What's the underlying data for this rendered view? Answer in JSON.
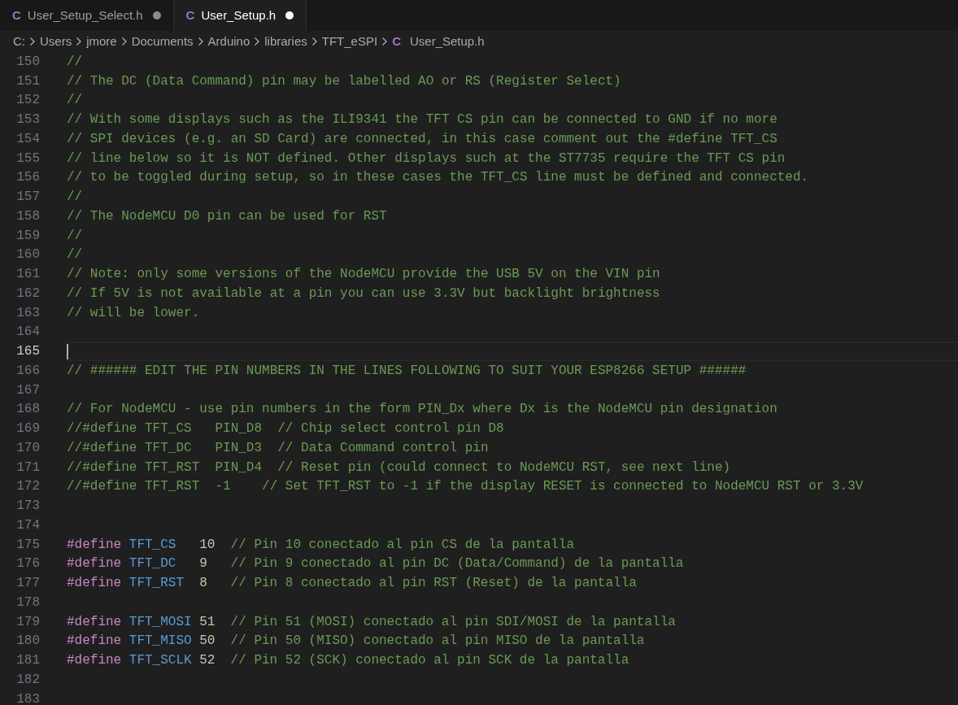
{
  "tabs": [
    {
      "label": "User_Setup_Select.h",
      "icon": "C",
      "modified": true,
      "selected": false
    },
    {
      "label": "User_Setup.h",
      "icon": "C",
      "modified": true,
      "selected": true
    }
  ],
  "breadcrumb": [
    {
      "text": "C:"
    },
    {
      "text": "Users"
    },
    {
      "text": "jmore"
    },
    {
      "text": "Documents"
    },
    {
      "text": "Arduino"
    },
    {
      "text": "libraries"
    },
    {
      "text": "TFT_eSPI"
    },
    {
      "text": "User_Setup.h",
      "icon": "C"
    }
  ],
  "lines": [
    {
      "number": "150",
      "current": false,
      "tokens": [
        {
          "kind": "comment",
          "text": "//"
        }
      ]
    },
    {
      "number": "151",
      "current": false,
      "tokens": [
        {
          "kind": "comment",
          "text": "// The DC (Data Command) pin may be labelled AO or RS (Register Select)"
        }
      ]
    },
    {
      "number": "152",
      "current": false,
      "tokens": [
        {
          "kind": "comment",
          "text": "//"
        }
      ]
    },
    {
      "number": "153",
      "current": false,
      "tokens": [
        {
          "kind": "comment",
          "text": "// With some displays such as the ILI9341 the TFT CS pin can be connected to GND if no more"
        }
      ]
    },
    {
      "number": "154",
      "current": false,
      "tokens": [
        {
          "kind": "comment",
          "text": "// SPI devices (e.g. an SD Card) are connected, in this case comment out the #define TFT_CS"
        }
      ]
    },
    {
      "number": "155",
      "current": false,
      "tokens": [
        {
          "kind": "comment",
          "text": "// line below so it is NOT defined. Other displays such at the ST7735 require the TFT CS pin"
        }
      ]
    },
    {
      "number": "156",
      "current": false,
      "tokens": [
        {
          "kind": "comment",
          "text": "// to be toggled during setup, so in these cases the TFT_CS line must be defined and connected."
        }
      ]
    },
    {
      "number": "157",
      "current": false,
      "tokens": [
        {
          "kind": "comment",
          "text": "//"
        }
      ]
    },
    {
      "number": "158",
      "current": false,
      "tokens": [
        {
          "kind": "comment",
          "text": "// The NodeMCU D0 pin can be used for RST"
        }
      ]
    },
    {
      "number": "159",
      "current": false,
      "tokens": [
        {
          "kind": "comment",
          "text": "//"
        }
      ]
    },
    {
      "number": "160",
      "current": false,
      "tokens": [
        {
          "kind": "comment",
          "text": "//"
        }
      ]
    },
    {
      "number": "161",
      "current": false,
      "tokens": [
        {
          "kind": "comment",
          "text": "// Note: only some versions of the NodeMCU provide the USB 5V on the VIN pin"
        }
      ]
    },
    {
      "number": "162",
      "current": false,
      "tokens": [
        {
          "kind": "comment",
          "text": "// If 5V is not available at a pin you can use 3.3V but backlight brightness"
        }
      ]
    },
    {
      "number": "163",
      "current": false,
      "tokens": [
        {
          "kind": "comment",
          "text": "// will be lower."
        }
      ]
    },
    {
      "number": "164",
      "current": false
    },
    {
      "number": "165",
      "current": true
    },
    {
      "number": "166",
      "current": false,
      "tokens": [
        {
          "kind": "comment",
          "text": "// ###### EDIT THE PIN NUMBERS IN THE LINES FOLLOWING TO SUIT YOUR ESP8266 SETUP ######"
        }
      ]
    },
    {
      "number": "167",
      "current": false
    },
    {
      "number": "168",
      "current": false,
      "tokens": [
        {
          "kind": "comment",
          "text": "// For NodeMCU - use pin numbers in the form PIN_Dx where Dx is the NodeMCU pin designation"
        }
      ]
    },
    {
      "number": "169",
      "current": false,
      "tokens": [
        {
          "kind": "comment",
          "text": "//#define TFT_CS   PIN_D8  // Chip select control pin D8"
        }
      ]
    },
    {
      "number": "170",
      "current": false,
      "tokens": [
        {
          "kind": "comment",
          "text": "//#define TFT_DC   PIN_D3  // Data Command control pin"
        }
      ]
    },
    {
      "number": "171",
      "current": false,
      "tokens": [
        {
          "kind": "comment",
          "text": "//#define TFT_RST  PIN_D4  // Reset pin (could connect to NodeMCU RST, see next line)"
        }
      ]
    },
    {
      "number": "172",
      "current": false,
      "tokens": [
        {
          "kind": "comment",
          "text": "//#define TFT_RST  -1    // Set TFT_RST to -1 if the display RESET is connected to NodeMCU RST or 3.3V"
        }
      ]
    },
    {
      "number": "173",
      "current": false
    },
    {
      "number": "174",
      "current": false
    },
    {
      "number": "175",
      "current": false,
      "tokens": [
        {
          "kind": "directive",
          "text": "#define"
        },
        {
          "kind": "macro",
          "text": "TFT_CS"
        },
        {
          "kind": "number",
          "text": "10"
        },
        {
          "kind": "comment",
          "text": "// Pin 10 conectado al pin CS de la pantalla"
        }
      ]
    },
    {
      "number": "176",
      "current": false,
      "tokens": [
        {
          "kind": "directive",
          "text": "#define"
        },
        {
          "kind": "macro",
          "text": "TFT_DC"
        },
        {
          "kind": "number",
          "text": "9"
        },
        {
          "kind": "comment",
          "text": "// Pin 9 conectado al pin DC (Data/Command) de la pantalla"
        }
      ]
    },
    {
      "number": "177",
      "current": false,
      "tokens": [
        {
          "kind": "directive",
          "text": "#define"
        },
        {
          "kind": "macro",
          "text": "TFT_RST"
        },
        {
          "kind": "number",
          "text": "8"
        },
        {
          "kind": "comment",
          "text": "// Pin 8 conectado al pin RST (Reset) de la pantalla"
        }
      ]
    },
    {
      "number": "178",
      "current": false
    },
    {
      "number": "179",
      "current": false,
      "tokens": [
        {
          "kind": "directive",
          "text": "#define"
        },
        {
          "kind": "macro",
          "text": "TFT_MOSI"
        },
        {
          "kind": "number",
          "text": "51"
        },
        {
          "kind": "comment",
          "text": "// Pin 51 (MOSI) conectado al pin SDI/MOSI de la pantalla"
        }
      ]
    },
    {
      "number": "180",
      "current": false,
      "tokens": [
        {
          "kind": "directive",
          "text": "#define"
        },
        {
          "kind": "macro",
          "text": "TFT_MISO"
        },
        {
          "kind": "number",
          "text": "50"
        },
        {
          "kind": "comment",
          "text": "// Pin 50 (MISO) conectado al pin MISO de la pantalla"
        }
      ]
    },
    {
      "number": "181",
      "current": false,
      "tokens": [
        {
          "kind": "directive",
          "text": "#define"
        },
        {
          "kind": "macro",
          "text": "TFT_SCLK"
        },
        {
          "kind": "number",
          "text": "52"
        },
        {
          "kind": "comment",
          "text": "// Pin 52 (SCK) conectado al pin SCK de la pantalla"
        }
      ]
    },
    {
      "number": "182",
      "current": false
    },
    {
      "number": "183",
      "current": false
    }
  ]
}
